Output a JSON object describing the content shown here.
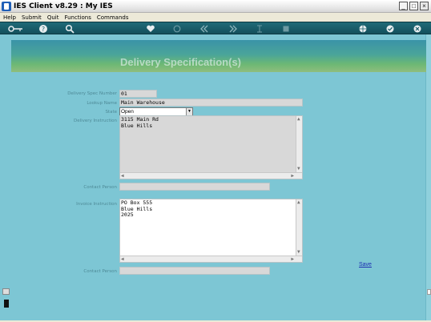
{
  "window": {
    "title": "IES Client v8.29 : My IES",
    "buttons": {
      "minimize": "_",
      "maximize": "□",
      "close": "×"
    }
  },
  "menu": {
    "items": [
      "Help",
      "Submit",
      "Quit",
      "Functions",
      "Commands"
    ]
  },
  "toolbar": {
    "icons": [
      "key-icon",
      "help-icon",
      "search-icon",
      "heart-icon",
      "refresh-icon",
      "rewind-icon",
      "forward-icon",
      "text-cursor-icon",
      "stop-icon",
      "globe-icon",
      "check-icon",
      "close-icon"
    ]
  },
  "page": {
    "title": "Delivery Specification(s)"
  },
  "form": {
    "spec_number": {
      "label": "Delivery Spec Number",
      "value": "01"
    },
    "lookup_name": {
      "label": "Lookup Name",
      "value": "Main Warehouse"
    },
    "state": {
      "label": "State",
      "value": "Open"
    },
    "delivery_instruction": {
      "label": "Delivery Instruction",
      "lines": [
        "3115 Main Rd",
        "Blue Hills"
      ]
    },
    "contact_person_1": {
      "label": "Contact Person",
      "value": ""
    },
    "invoice_instruction": {
      "label": "Invoice Instruction",
      "lines": [
        "PO Box 555",
        "Blue Hills",
        "2025"
      ]
    },
    "contact_person_2": {
      "label": "Contact Person",
      "value": ""
    },
    "save_label": "Save"
  },
  "colors": {
    "background": "#7dc6d4",
    "toolbar": "#1a5d6a",
    "link": "#1e2fb0"
  }
}
